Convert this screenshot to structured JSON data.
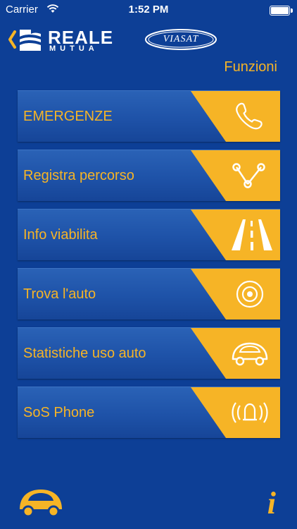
{
  "status_bar": {
    "carrier": "Carrier",
    "time": "1:52 PM"
  },
  "header": {
    "brand_line1": "REALE",
    "brand_line2": "MUTUA",
    "partner_logo_text": "VIASAT",
    "section_title": "Funzioni"
  },
  "menu": {
    "items": [
      {
        "label": "EMERGENZE",
        "icon": "phone-icon"
      },
      {
        "label": "Registra percorso",
        "icon": "route-icon"
      },
      {
        "label": "Info viabilita",
        "icon": "road-icon"
      },
      {
        "label": "Trova l'auto",
        "icon": "target-icon"
      },
      {
        "label": "Statistiche uso auto",
        "icon": "car-icon"
      },
      {
        "label": "SoS Phone",
        "icon": "alarm-bell-icon"
      }
    ]
  },
  "footer": {
    "left_icon": "car-icon",
    "right_icon": "info-icon",
    "info_glyph": "i"
  },
  "colors": {
    "background": "#0d3f96",
    "button": "#1e52a8",
    "accent": "#f6b426",
    "text_on_button": "#f6b426"
  }
}
